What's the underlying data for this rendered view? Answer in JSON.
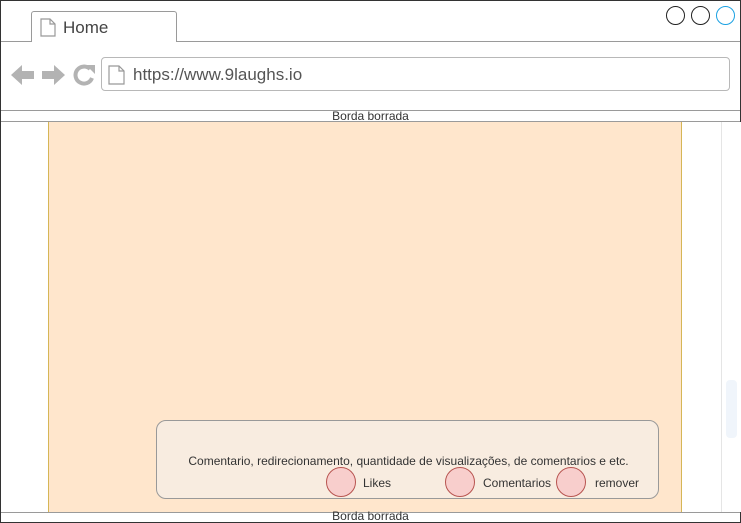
{
  "browser": {
    "tab_title": "Home",
    "url": "https://www.9laughs.io",
    "window_controls": [
      "minimize",
      "maximize",
      "close"
    ]
  },
  "viewport": {
    "top_border_caption": "Borda borrada",
    "bottom_border_caption": "Borda borrada"
  },
  "info_card": {
    "text": "Comentario, redirecionamento, quantidade de visualizações, de comentarios e etc.",
    "actions": [
      {
        "label": "Likes",
        "icon": "like-icon"
      },
      {
        "label": "Comentarios",
        "icon": "comment-icon"
      },
      {
        "label": "remover",
        "icon": "remove-icon"
      }
    ]
  },
  "colors": {
    "panel_fill": "#ffe6cc",
    "panel_border": "#d6b656",
    "card_fill": "#f8ece0",
    "action_fill": "#f8cecc",
    "action_border": "#b85450",
    "nav_icon": "#b3b3b3",
    "close_accent": "#1ba1e2"
  }
}
